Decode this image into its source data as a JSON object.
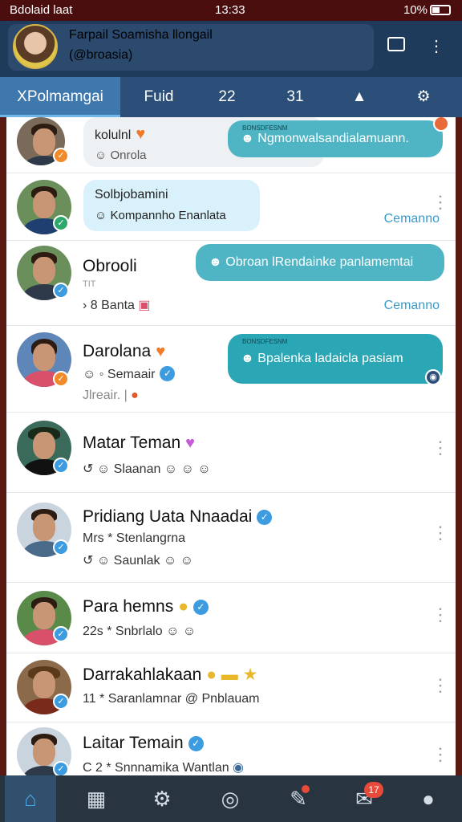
{
  "status_bar": {
    "carrier": "Bdolaid laat",
    "time": "13:33",
    "battery": "10%"
  },
  "header": {
    "name": "Farpail Soamisha llongail",
    "handle": "(@broasia)"
  },
  "tabs": [
    {
      "label": "XPolmamgai"
    },
    {
      "label": "Fuid"
    },
    {
      "label": "22"
    },
    {
      "label": "31"
    }
  ],
  "chats": [
    {
      "name": "kolulnl",
      "bubble_title": "",
      "line1": "Onrola",
      "tag": "BONSDFESNM",
      "message": "Ngmonwalsandialamuann.",
      "meta": ""
    },
    {
      "name": "",
      "bubble_title": "Solbjobamini",
      "line1": "Kompannho Enanlata",
      "message": "",
      "meta": "Cemanno"
    },
    {
      "name": "Obrooli",
      "line0": "TIT",
      "line1": "8  Banta",
      "message": "Obroan lRendainke panlamemtai",
      "meta": "Cemanno"
    },
    {
      "name": "Darolana",
      "line0": "Semaair",
      "line1": "Jlreair.  |",
      "tag": "BONSDFESNM",
      "message": "Bpalenka ladaicla pasiam"
    },
    {
      "name": "Matar Teman",
      "line1": "Slaanan"
    },
    {
      "name": "Pridiang Uata Nnaadai",
      "line0": "Mrs  *  Stenlangrna",
      "line1": "Saunlak"
    },
    {
      "name": "Para hemns",
      "line1": "22s  *  Snbrlalo"
    },
    {
      "name": "Darrakahlakaan",
      "line1": "11  *  Saranlamnar  @ Pnblauam"
    },
    {
      "name": "Laitar Temain",
      "line1": "C  2  *  Snnnamika Wantlan"
    }
  ],
  "colors": {
    "header": "#1f3b5c",
    "tabs": "#2b4f78",
    "accent": "#3d9be0",
    "bubble_teal": "#4fb4c4"
  },
  "bottom_nav": {
    "messages_badge": "17"
  },
  "icons": [
    "home-icon",
    "map-icon",
    "settings-icon",
    "camera-icon",
    "pin-icon",
    "messages-icon",
    "profile-icon"
  ]
}
